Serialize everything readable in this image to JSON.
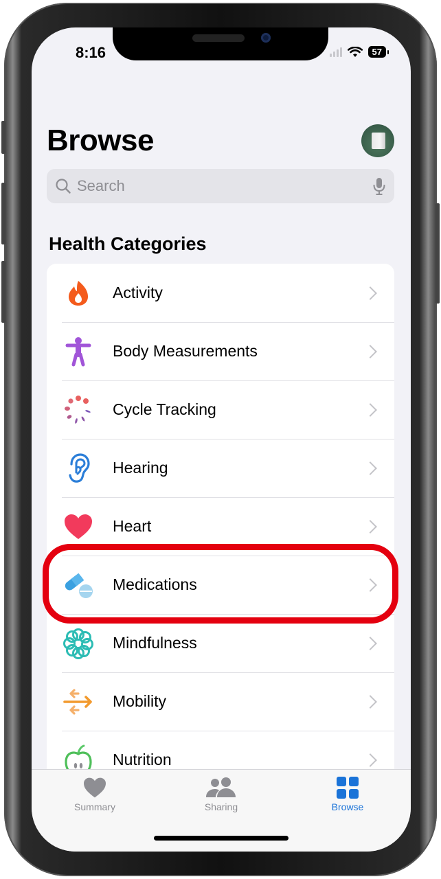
{
  "status_bar": {
    "time": "8:16",
    "battery": "57"
  },
  "header": {
    "title": "Browse"
  },
  "search": {
    "placeholder": "Search"
  },
  "section": {
    "title": "Health Categories"
  },
  "categories": [
    {
      "label": "Activity",
      "icon": "flame-icon",
      "color": "#f45b1c"
    },
    {
      "label": "Body Measurements",
      "icon": "figure-icon",
      "color": "#a155d8"
    },
    {
      "label": "Cycle Tracking",
      "icon": "cycle-dots-icon",
      "color": "#e0666f"
    },
    {
      "label": "Hearing",
      "icon": "ear-icon",
      "color": "#2b7ed8"
    },
    {
      "label": "Heart",
      "icon": "heart-icon",
      "color": "#f23a5c"
    },
    {
      "label": "Medications",
      "icon": "pills-icon",
      "color": "#3aa0e0"
    },
    {
      "label": "Mindfulness",
      "icon": "flower-icon",
      "color": "#2cbcb4"
    },
    {
      "label": "Mobility",
      "icon": "arrows-icon",
      "color": "#f29a2e"
    },
    {
      "label": "Nutrition",
      "icon": "apple-icon",
      "color": "#4fbf5a"
    }
  ],
  "highlighted_item": "Medications",
  "tabbar": {
    "tabs": [
      {
        "label": "Summary",
        "icon": "heart-icon",
        "active": false
      },
      {
        "label": "Sharing",
        "icon": "people-icon",
        "active": false
      },
      {
        "label": "Browse",
        "icon": "grid-icon",
        "active": true
      }
    ],
    "active_color": "#1a73d8",
    "inactive_color": "#8e8e93"
  }
}
